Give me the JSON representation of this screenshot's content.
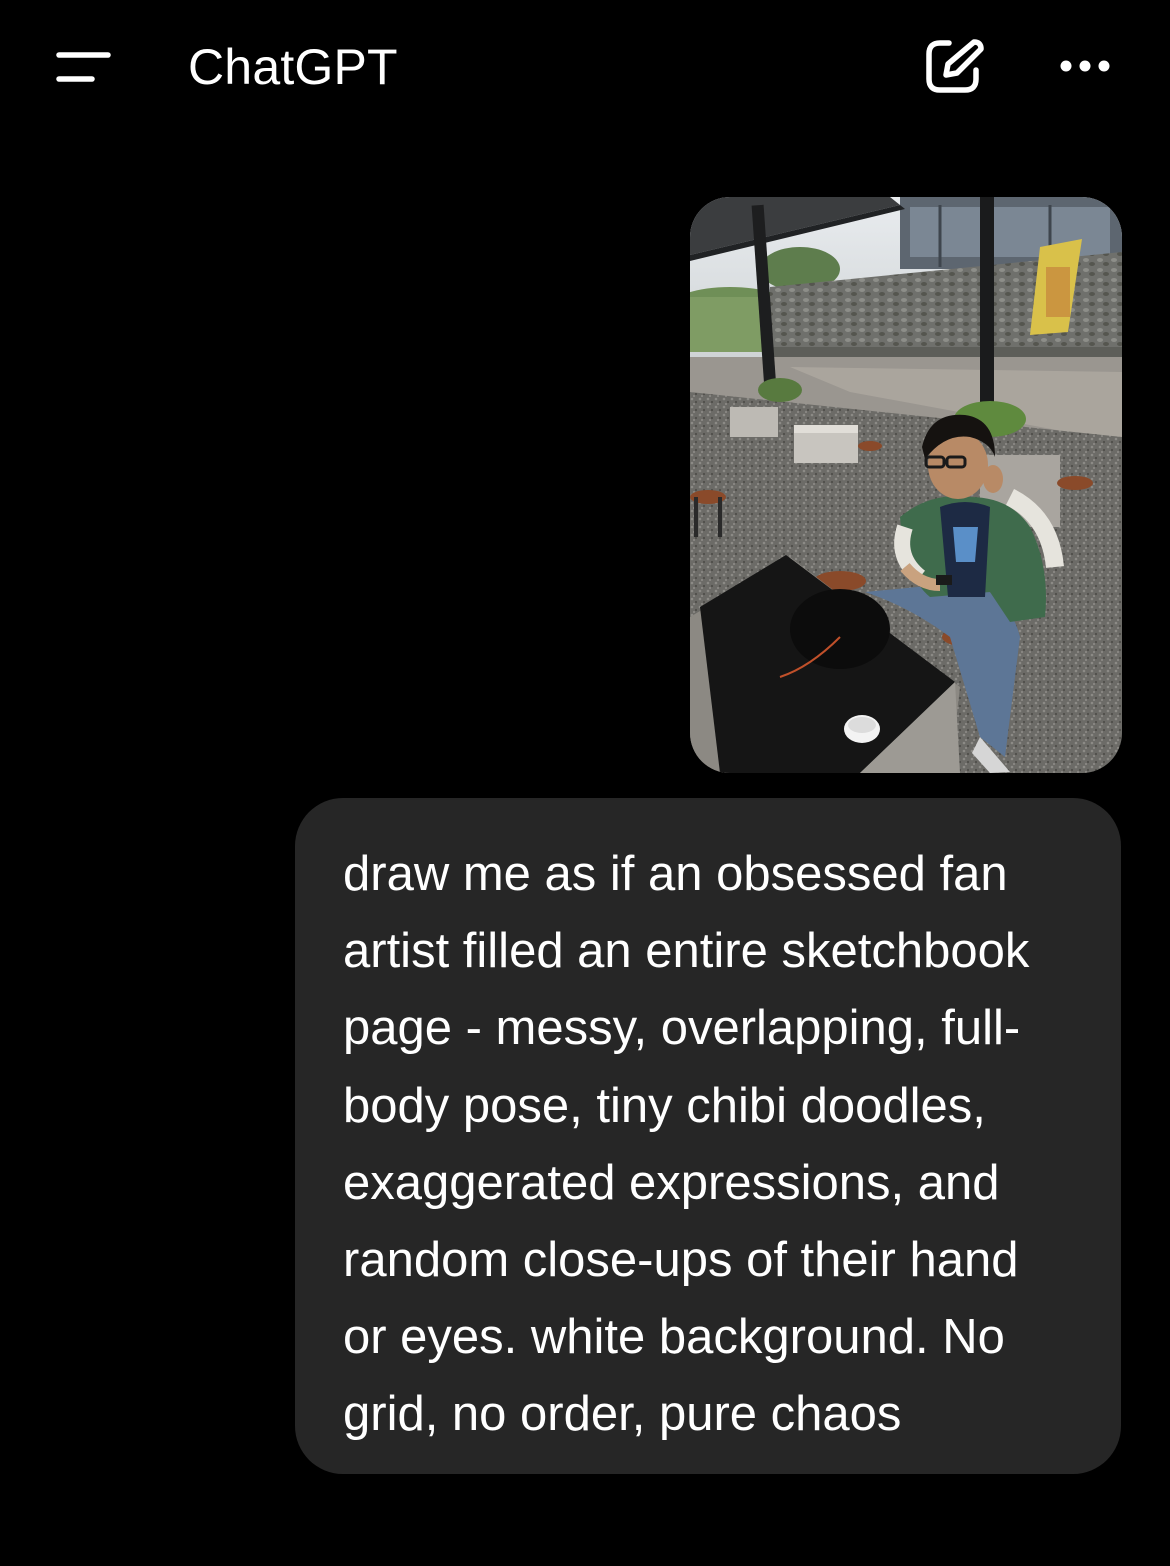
{
  "header": {
    "title": "ChatGPT",
    "menu_icon": "menu-icon",
    "compose_icon": "new-chat-icon",
    "more_icon": "more-options-icon"
  },
  "conversation": {
    "user_image": {
      "kind": "photo",
      "icon": "user-photo-attachment"
    },
    "user_message": {
      "lines": [
        "draw me as if an obsessed fan",
        "artist filled an entire sketchbook",
        "page - messy, overlapping, full-",
        "body pose, tiny chibi doodles,",
        "exaggerated expressions, and",
        "random close-ups of their hand",
        "or eyes. white background. No",
        "grid, no order, pure chaos"
      ]
    }
  },
  "colors": {
    "background": "#000000",
    "bubble": "#262626",
    "text": "#ffffff"
  }
}
